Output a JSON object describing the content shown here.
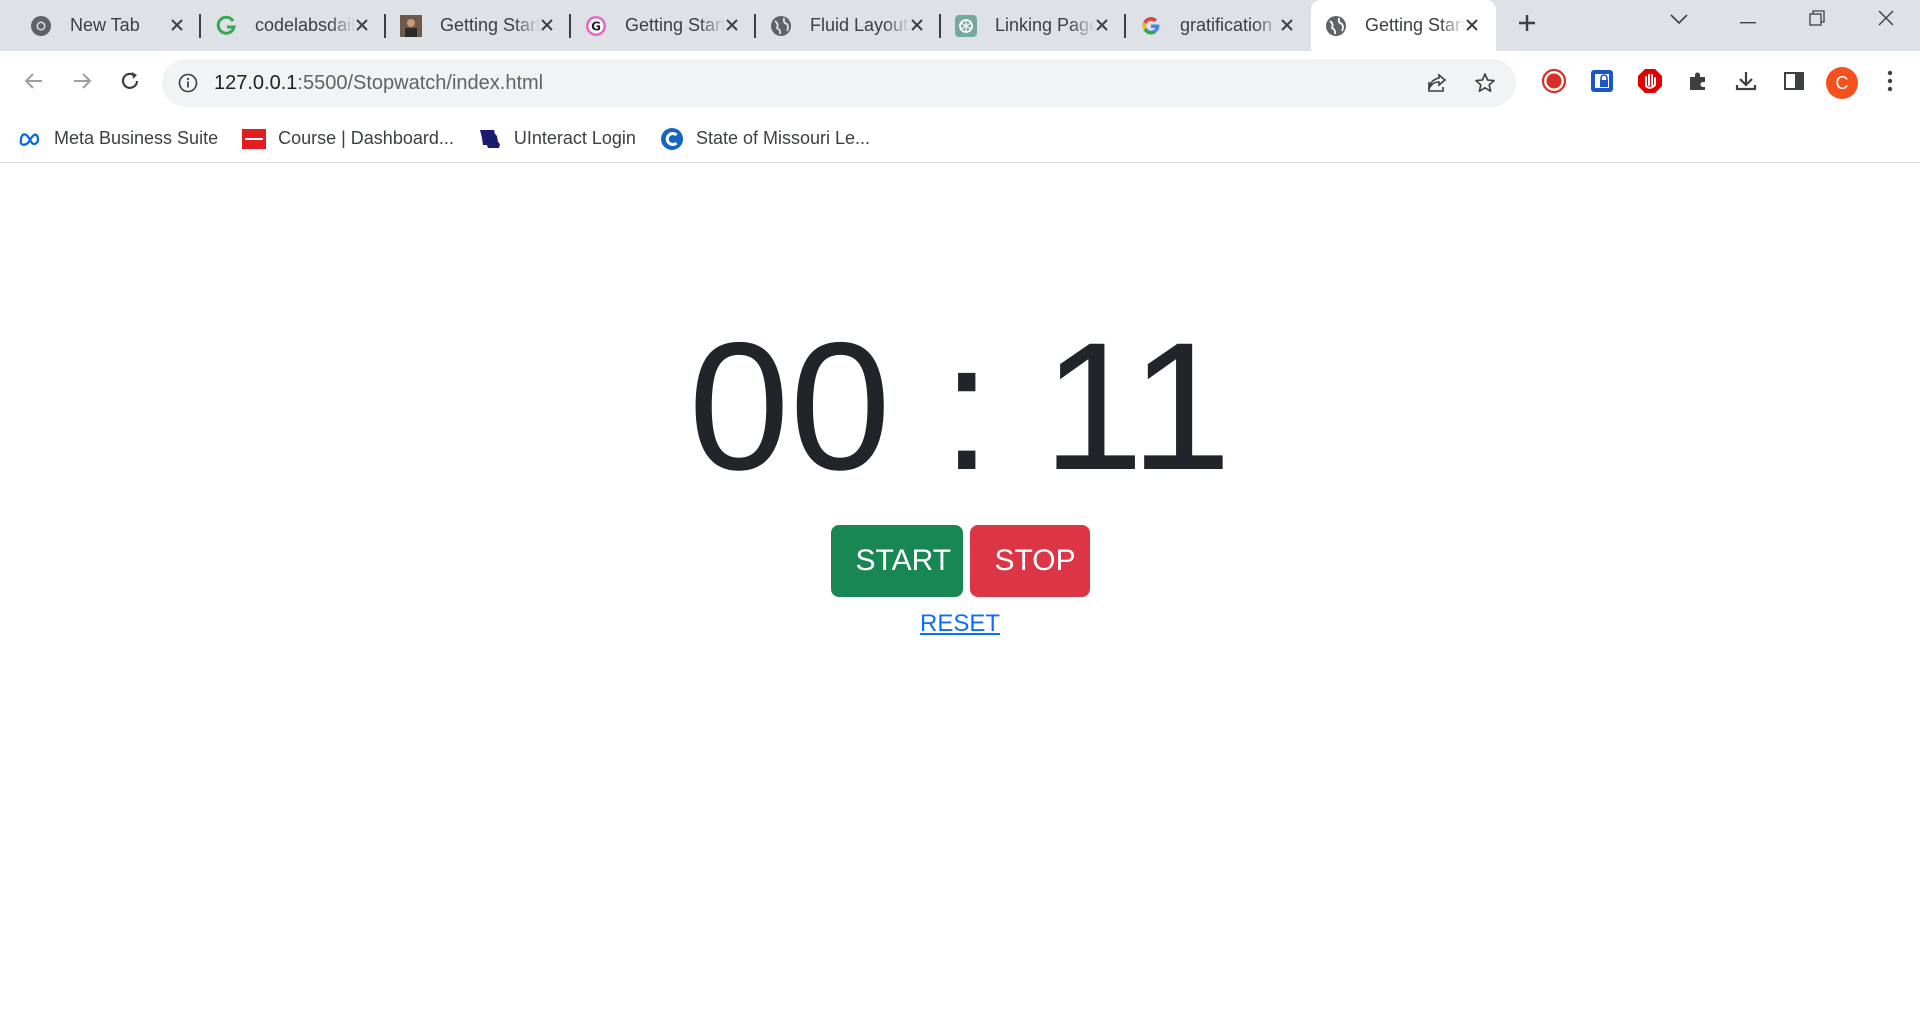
{
  "browser": {
    "tabs": [
      {
        "title": "New Tab",
        "icon": "chrome-icon"
      },
      {
        "title": "codelabsdaily",
        "icon": "codelabs-g-icon"
      },
      {
        "title": "Getting Started",
        "icon": "profile-photo-icon"
      },
      {
        "title": "Getting Started",
        "icon": "g-circle-icon"
      },
      {
        "title": "Fluid Layouts",
        "icon": "globe-icon"
      },
      {
        "title": "Linking Pages",
        "icon": "chatgpt-icon"
      },
      {
        "title": "gratification",
        "icon": "google-icon"
      },
      {
        "title": "Getting Started",
        "icon": "globe-icon",
        "active": true
      }
    ],
    "url": {
      "host": "127.0.0.1",
      "path": ":5500/Stopwatch/index.html"
    },
    "profile_initial": "C",
    "bookmarks": [
      {
        "label": "Meta Business Suite",
        "icon": "meta-icon"
      },
      {
        "label": "Course | Dashboard...",
        "icon": "ec-council-icon"
      },
      {
        "label": "UInteract Login",
        "icon": "missouri-icon"
      },
      {
        "label": "State of Missouri Le...",
        "icon": "c-logo-icon"
      }
    ]
  },
  "stopwatch": {
    "display": "00 : 11",
    "start_label": "START",
    "stop_label": "STOP",
    "reset_label": "RESET"
  },
  "colors": {
    "start": "#198754",
    "stop": "#dc3545",
    "link": "#0d6efd",
    "timer_text": "#212529",
    "avatar": "#f4511e"
  }
}
